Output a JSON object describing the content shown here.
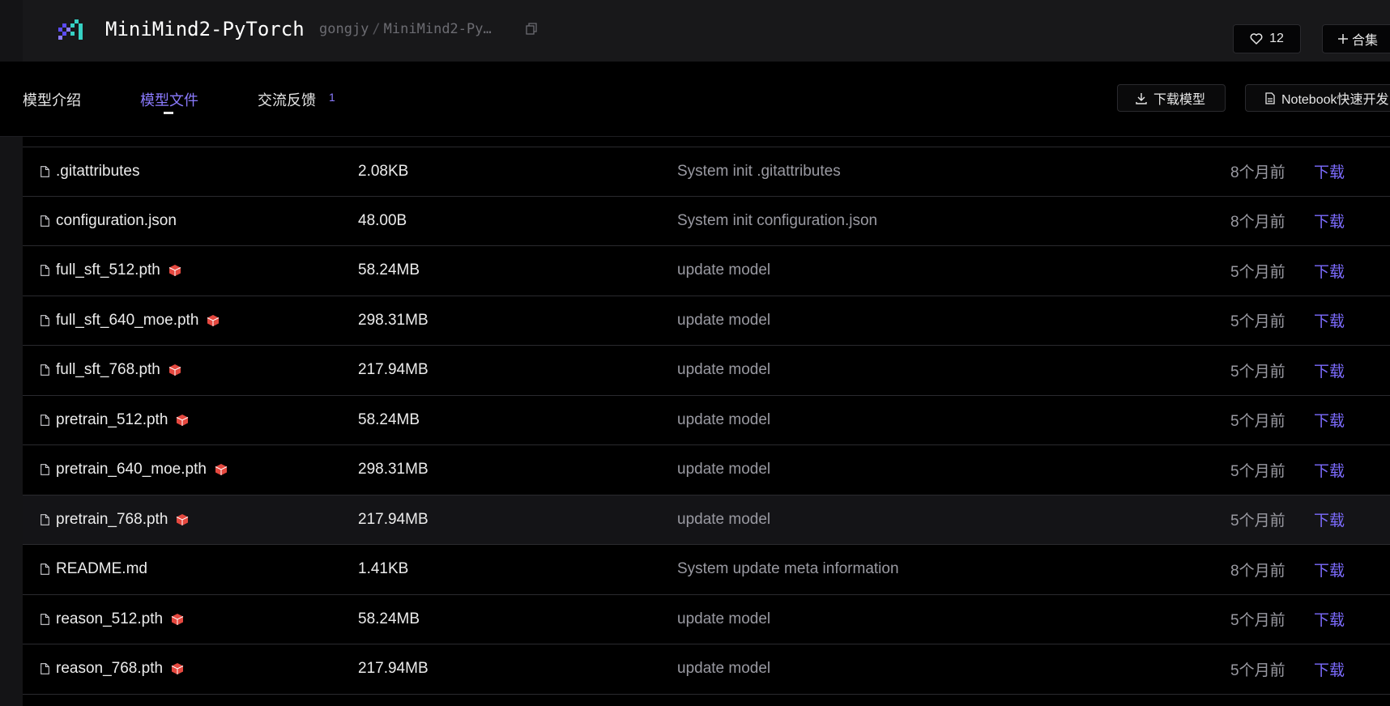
{
  "header": {
    "repo_name": "MiniMind2-PyTorch",
    "owner": "gongjy",
    "path_sep": "/",
    "repo_short": "MiniMind2-Py…",
    "likes": "12",
    "collect_label": "合集"
  },
  "tabs": [
    {
      "label": "模型介绍"
    },
    {
      "label": "模型文件"
    },
    {
      "label": "交流反馈",
      "badge": "1"
    }
  ],
  "actions": {
    "download_model": "下载模型",
    "notebook": "Notebook快速开发"
  },
  "files": [
    {
      "name": ".gitattributes",
      "size": "2.08KB",
      "commit": "System init .gitattributes",
      "time": "8个月前",
      "action": "下载",
      "lfs": false
    },
    {
      "name": "configuration.json",
      "size": "48.00B",
      "commit": "System init configuration.json",
      "time": "8个月前",
      "action": "下载",
      "lfs": false
    },
    {
      "name": "full_sft_512.pth",
      "size": "58.24MB",
      "commit": "update model",
      "time": "5个月前",
      "action": "下载",
      "lfs": true
    },
    {
      "name": "full_sft_640_moe.pth",
      "size": "298.31MB",
      "commit": "update model",
      "time": "5个月前",
      "action": "下载",
      "lfs": true
    },
    {
      "name": "full_sft_768.pth",
      "size": "217.94MB",
      "commit": "update model",
      "time": "5个月前",
      "action": "下载",
      "lfs": true
    },
    {
      "name": "pretrain_512.pth",
      "size": "58.24MB",
      "commit": "update model",
      "time": "5个月前",
      "action": "下载",
      "lfs": true
    },
    {
      "name": "pretrain_640_moe.pth",
      "size": "298.31MB",
      "commit": "update model",
      "time": "5个月前",
      "action": "下载",
      "lfs": true
    },
    {
      "name": "pretrain_768.pth",
      "size": "217.94MB",
      "commit": "update model",
      "time": "5个月前",
      "action": "下载",
      "lfs": true
    },
    {
      "name": "README.md",
      "size": "1.41KB",
      "commit": "System update meta information",
      "time": "8个月前",
      "action": "下载",
      "lfs": false
    },
    {
      "name": "reason_512.pth",
      "size": "58.24MB",
      "commit": "update model",
      "time": "5个月前",
      "action": "下载",
      "lfs": true
    },
    {
      "name": "reason_768.pth",
      "size": "217.94MB",
      "commit": "update model",
      "time": "5个月前",
      "action": "下载",
      "lfs": true
    }
  ],
  "colors": {
    "accent": "#8b7bff",
    "link": "#7d6cff",
    "background": "#000000",
    "lfs_badge": "#e5483f"
  }
}
